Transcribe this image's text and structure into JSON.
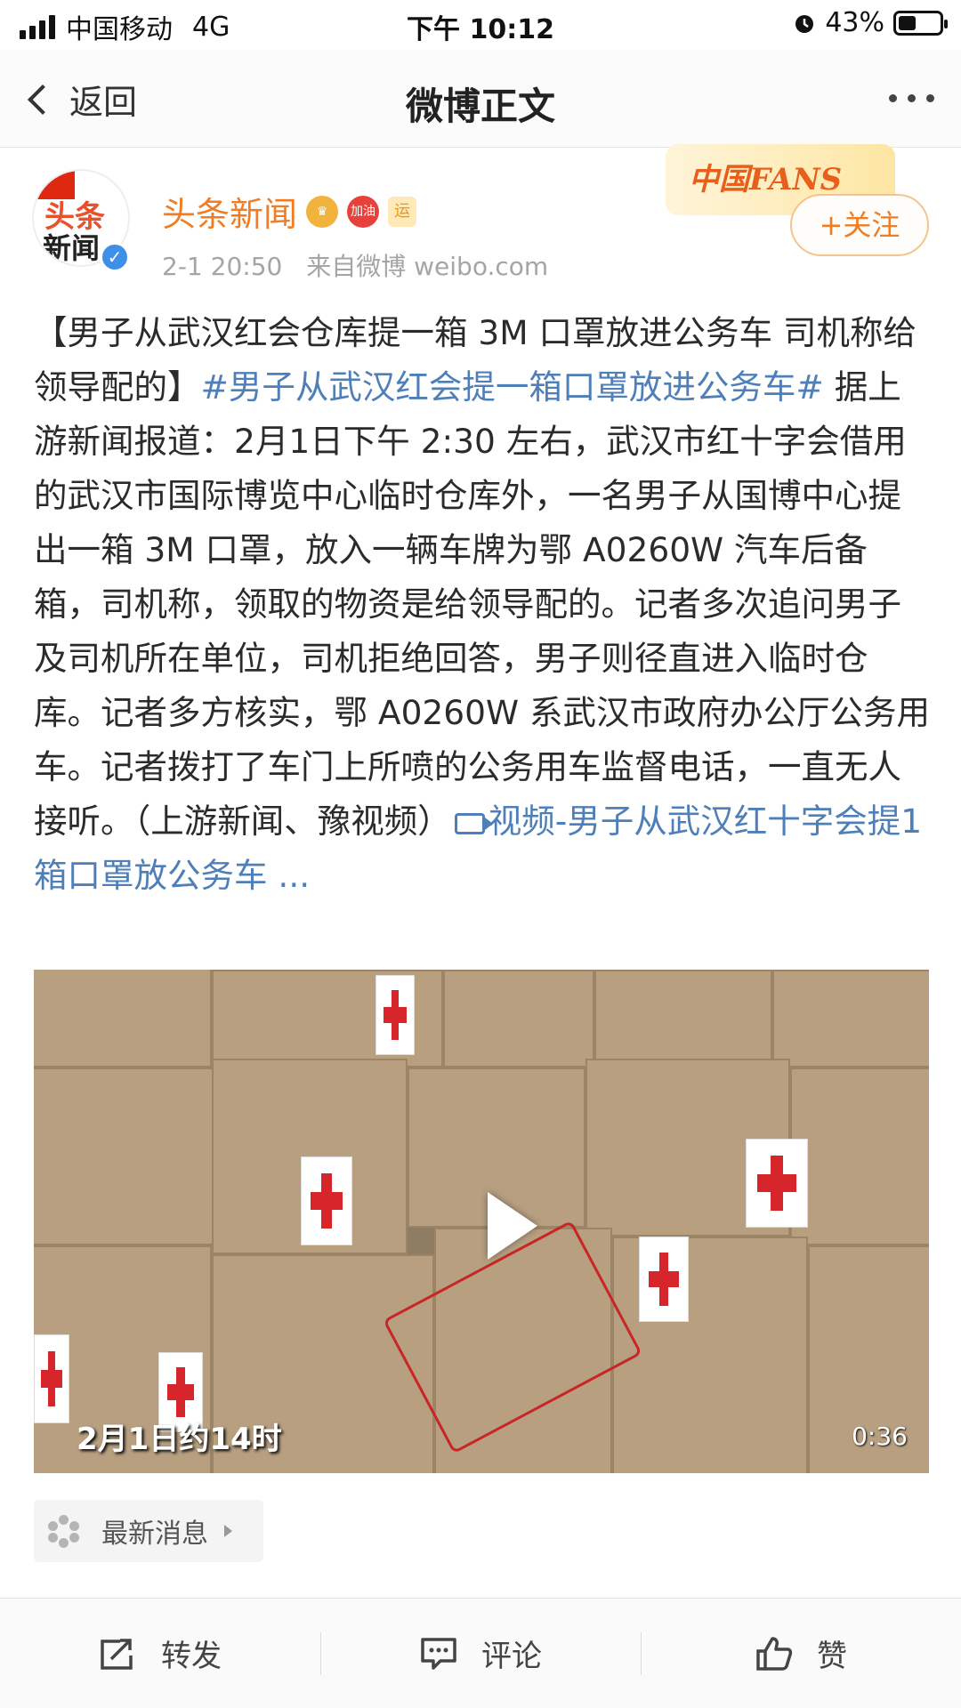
{
  "status_bar": {
    "carrier": "中国移动",
    "network": "4G",
    "time": "下午 10:12",
    "battery_percent": "43%",
    "battery_level": 0.43
  },
  "nav": {
    "back_label": "返回",
    "title": "微博正文"
  },
  "post": {
    "avatar_text_top": "头条",
    "avatar_text_bottom": "新闻",
    "username": "头条新闻",
    "badges": [
      "加油",
      "运"
    ],
    "timestamp": "2-1 20:50",
    "source": "来自微博 weibo.com",
    "fans_banner": "中国FANS",
    "follow_label": "+关注",
    "text_part1": "【男子从武汉红会仓库提一箱 3M 口罩放进公务车 司机称给领导配的】",
    "hashtag": "#男子从武汉红会提一箱口罩放进公务车#",
    "text_part2": " 据上游新闻报道：2月1日下午 2:30 左右，武汉市红十字会借用的武汉市国际博览中心临时仓库外，一名男子从国博中心提出一箱 3M 口罩，放入一辆车牌为鄂 A0260W 汽车后备箱，司机称，领取的物资是给领导配的。记者多次追问男子及司机所在单位，司机拒绝回答，男子则径直进入临时仓库。记者多方核实，鄂 A0260W 系武汉市政府办公厅公务用车。记者拨打了车门上所喷的公务用车监督电话，一直无人接听。（上游新闻、豫视频）",
    "video_link": "视频-男子从武汉红十字会提1箱口罩放公务车 ...",
    "video": {
      "caption": "2月1日约14时",
      "duration": "0:36"
    },
    "latest_news_label": "最新消息"
  },
  "actions": {
    "repost": "转发",
    "comment": "评论",
    "like": "赞"
  },
  "colors": {
    "username": "#f07d23",
    "link": "#4f7fb8",
    "verified": "#3d8fe8"
  }
}
